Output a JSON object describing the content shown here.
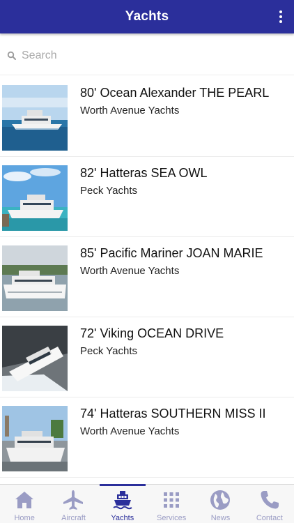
{
  "header": {
    "title": "Yachts"
  },
  "search": {
    "placeholder": "Search"
  },
  "yachts": [
    {
      "title": "80' Ocean Alexander THE PEARL",
      "broker": "Worth Avenue Yachts"
    },
    {
      "title": "82' Hatteras SEA OWL",
      "broker": "Peck Yachts"
    },
    {
      "title": "85' Pacific Mariner JOAN MARIE",
      "broker": "Worth Avenue Yachts"
    },
    {
      "title": "72' Viking OCEAN DRIVE",
      "broker": "Peck Yachts"
    },
    {
      "title": "74' Hatteras SOUTHERN MISS II",
      "broker": "Worth Avenue Yachts"
    }
  ],
  "tabs": [
    {
      "label": "Home",
      "icon": "home-icon"
    },
    {
      "label": "Aircraft",
      "icon": "airplane-icon"
    },
    {
      "label": "Yachts",
      "icon": "ship-icon"
    },
    {
      "label": "Services",
      "icon": "grid-icon"
    },
    {
      "label": "News",
      "icon": "globe-icon"
    },
    {
      "label": "Contact",
      "icon": "phone-icon"
    }
  ],
  "colors": {
    "brand": "#2b2f9b",
    "inactive_tab": "#9a9cc4"
  }
}
